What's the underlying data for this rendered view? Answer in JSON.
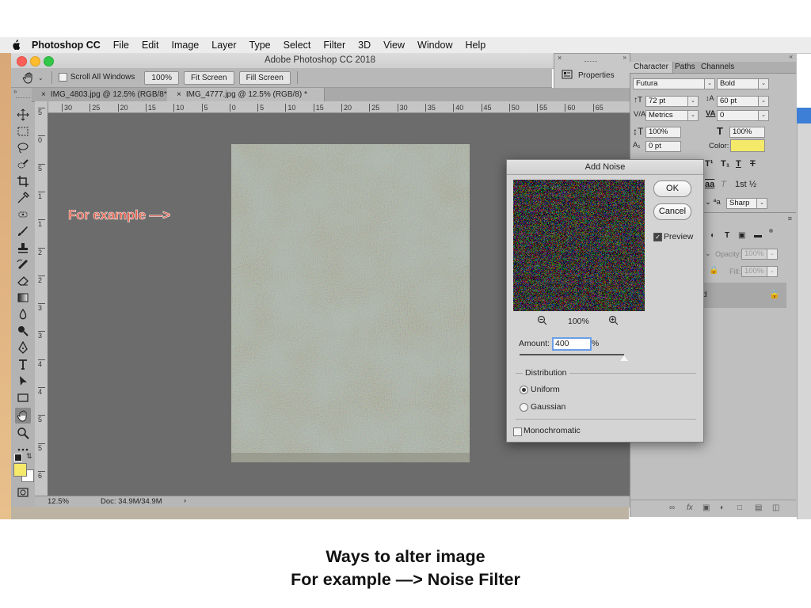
{
  "menubar": {
    "app_name": "Photoshop CC",
    "items": [
      "File",
      "Edit",
      "Image",
      "Layer",
      "Type",
      "Select",
      "Filter",
      "3D",
      "View",
      "Window",
      "Help"
    ]
  },
  "window": {
    "title": "Adobe Photoshop CC 2018"
  },
  "options_bar": {
    "scroll_all_windows": "Scroll All Windows",
    "zoom_100": "100%",
    "fit_screen": "Fit Screen",
    "fill_screen": "Fill Screen"
  },
  "doc_tabs": [
    {
      "label": "IMG_4803.jpg @ 12.5% (RGB/8*)"
    },
    {
      "label": "IMG_4777.jpg @ 12.5% (RGB/8) *"
    }
  ],
  "ruler_top_labels": [
    "30",
    "25",
    "20",
    "15",
    "10",
    "5",
    "0",
    "5",
    "10",
    "15",
    "20",
    "25",
    "30",
    "35",
    "40",
    "45",
    "50",
    "55",
    "60",
    "65"
  ],
  "ruler_left_labels": [
    "5",
    "0",
    "5",
    "1",
    "1",
    "2",
    "2",
    "3",
    "3",
    "4",
    "4",
    "5",
    "5",
    "6"
  ],
  "status_bar": {
    "zoom": "12.5%",
    "doc_size": "Doc: 34.9M/34.9M",
    "arrow": "›"
  },
  "properties_panel": {
    "label": "Properties"
  },
  "character_panel": {
    "tabs": [
      "Character",
      "Paths",
      "Channels"
    ],
    "font_family": "Futura",
    "font_style": "Bold",
    "font_size": "72 pt",
    "leading": "60 pt",
    "kerning": "Metrics",
    "tracking": "0",
    "vertical_scale": "100%",
    "horizontal_scale": "100%",
    "baseline_shift": "0 pt",
    "color_label": "Color:",
    "color_swatch": "#f5e96a",
    "antialias": "Sharp",
    "typo_glyphs": [
      "T¹",
      "T₁",
      "T",
      "T"
    ],
    "opentype": [
      "aa",
      "T",
      "1st",
      "½"
    ],
    "aa_label": "ªa"
  },
  "layers_panel": {
    "opacity_label": "Opacity:",
    "opacity_value": "100%",
    "fill_label": "Fill:",
    "fill_value": "100%",
    "layer_name_fragment": "d"
  },
  "add_noise_dialog": {
    "title": "Add Noise",
    "ok": "OK",
    "cancel": "Cancel",
    "preview_label": "Preview",
    "preview_checked": true,
    "zoom": "100%",
    "amount_label": "Amount:",
    "amount_value": "400",
    "amount_unit": "%",
    "amount_slider_fraction": 1.0,
    "distribution_label": "Distribution",
    "options": [
      "Uniform",
      "Gaussian"
    ],
    "selected_option": "Uniform",
    "monochromatic_label": "Monochromatic",
    "monochromatic_checked": false
  },
  "annotation": "For example —>",
  "colors": {
    "annotation": "#e35a47",
    "foreground_swatch": "#f5e96a",
    "selected_field": "#cfe0f7"
  },
  "caption": {
    "line1": "Ways to alter image",
    "line2": "For example —> Noise Filter"
  }
}
